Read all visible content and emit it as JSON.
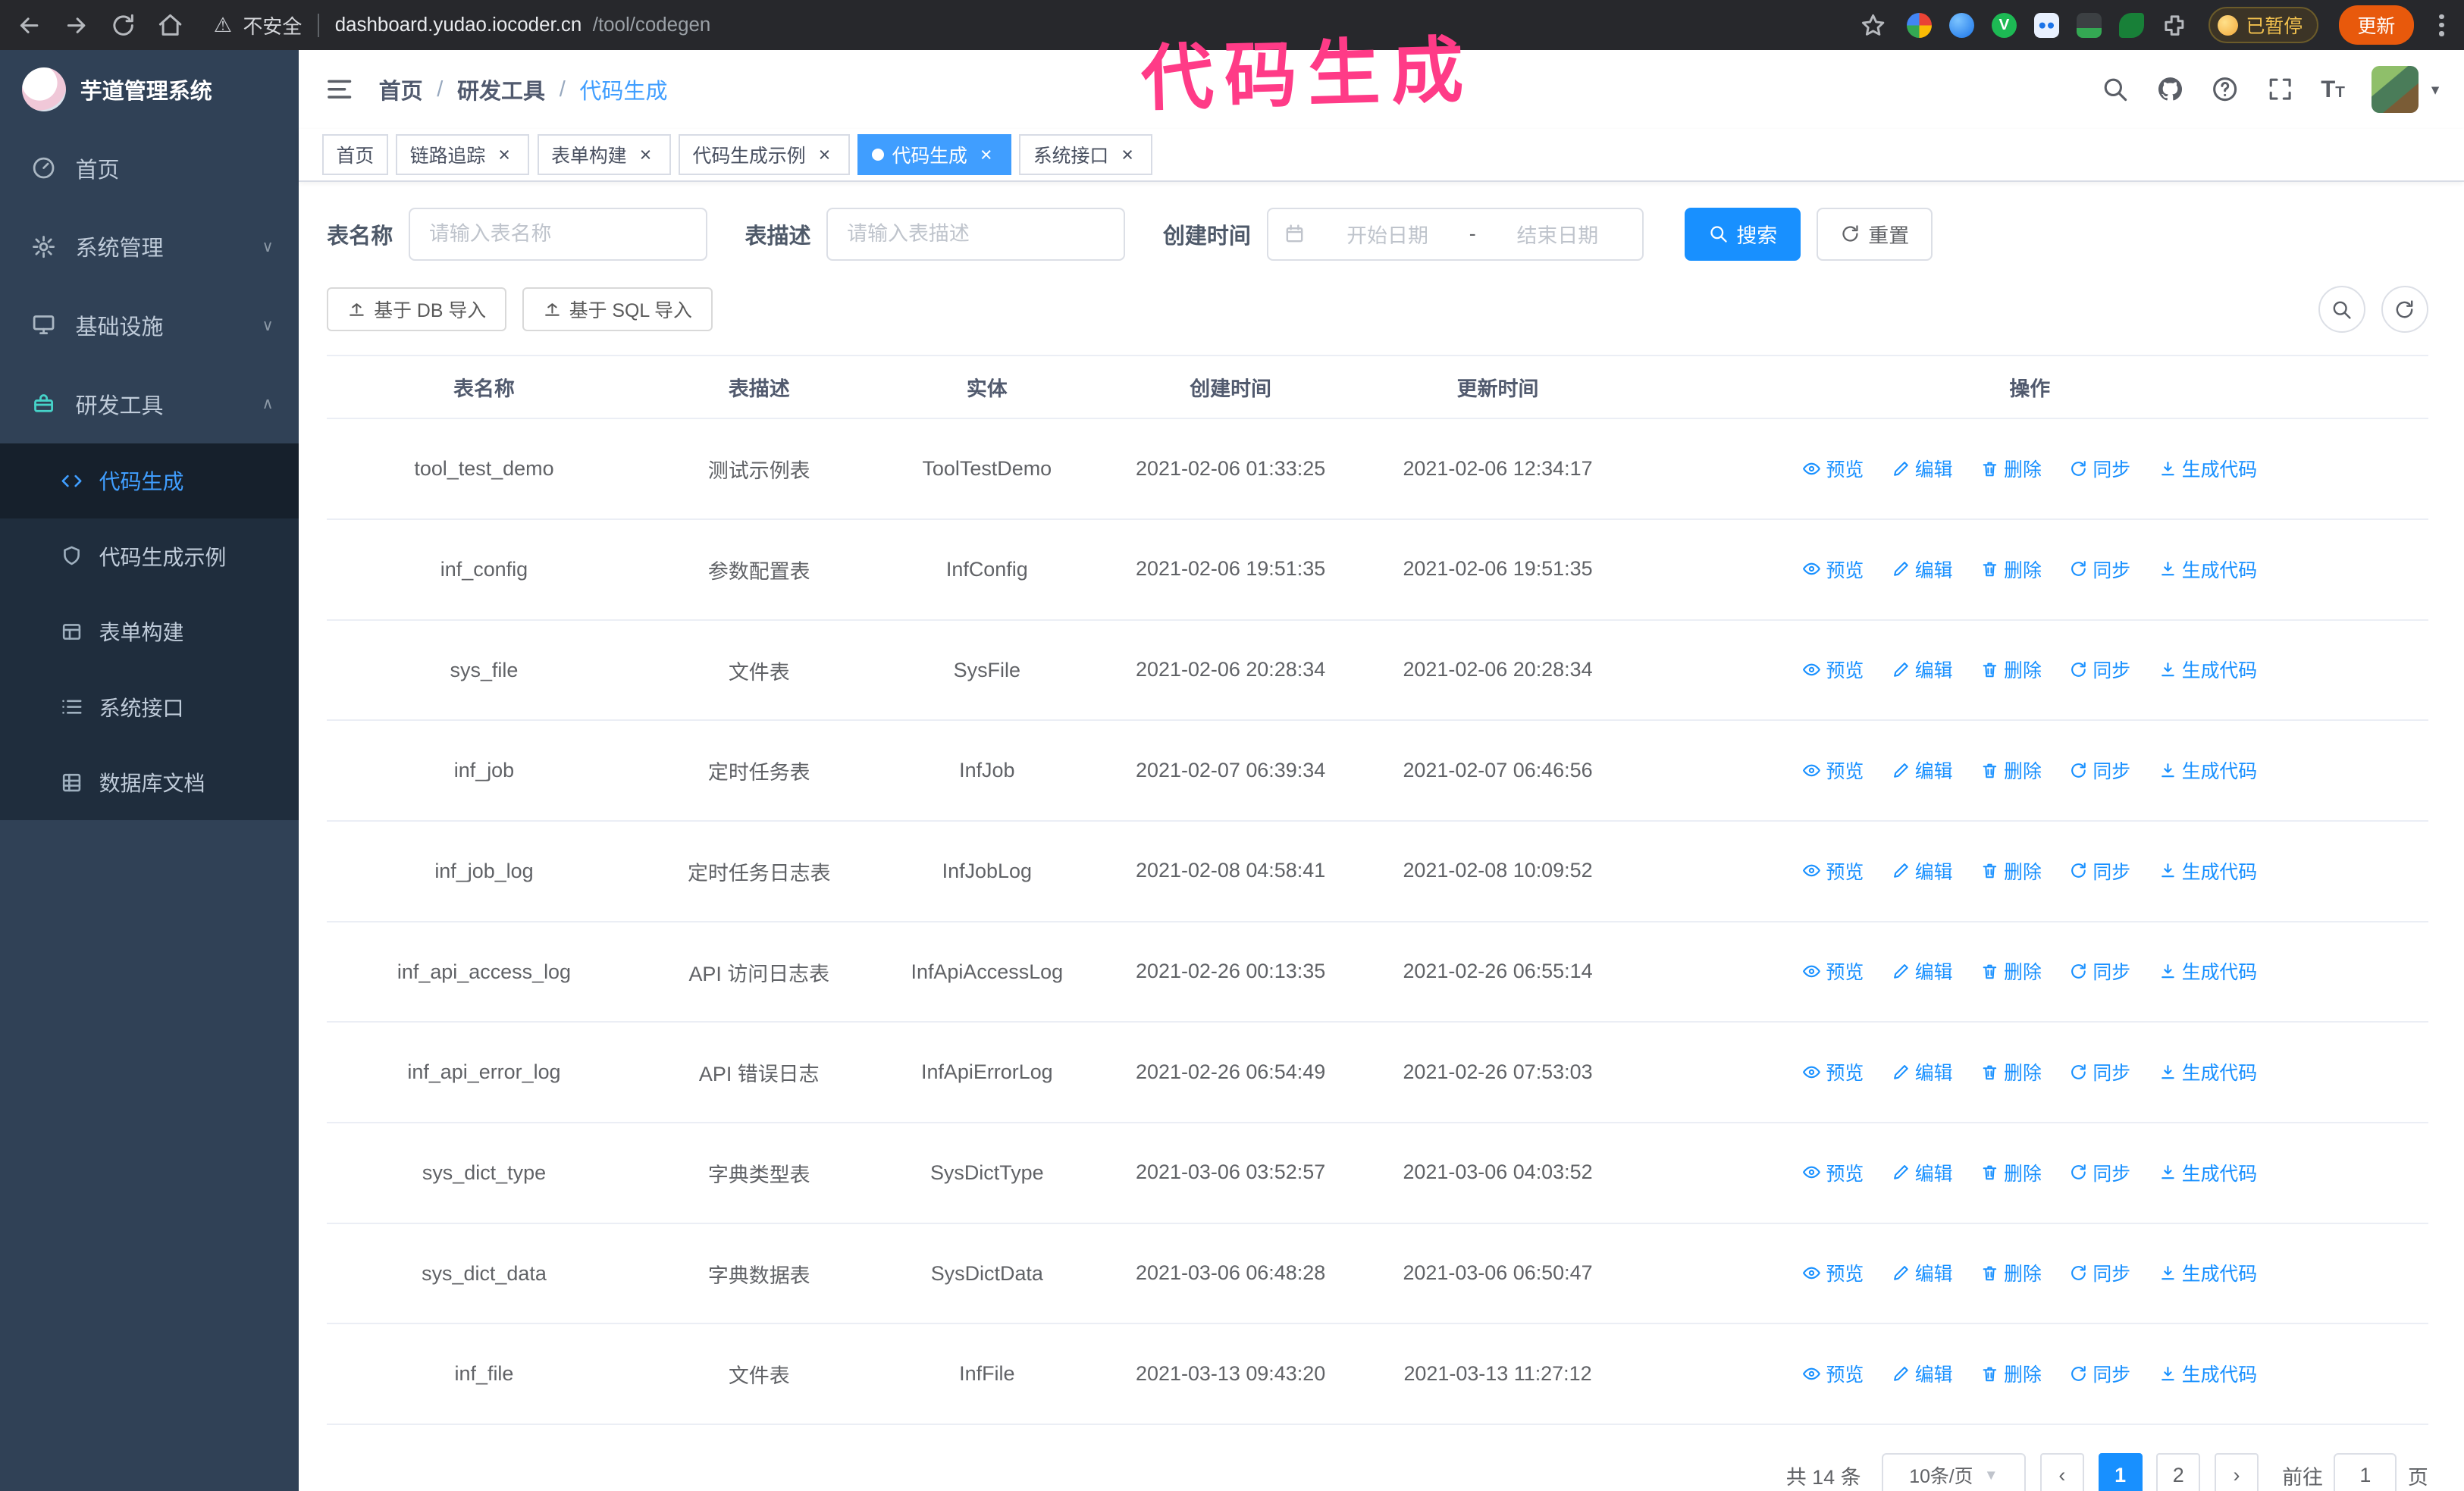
{
  "theme": {
    "primary": "#1890ff",
    "accent": "#409eff",
    "sidebar_bg": "#304156",
    "submenu_bg": "#1f2d3d",
    "chrome_bg": "#27282c",
    "annotation": "#ff3b87",
    "update_btn": "#e8590c"
  },
  "annotation": {
    "text": "代码生成"
  },
  "browser": {
    "security_label": "不安全",
    "url_host": "dashboard.yudao.iocoder.cn",
    "url_path": "/tool/codegen",
    "paused_badge": "已暂停",
    "update_button": "更新"
  },
  "sidebar": {
    "logo_title": "芋道管理系统",
    "items": [
      {
        "label": "首页",
        "chevron": ""
      },
      {
        "label": "系统管理",
        "chevron": "∨"
      },
      {
        "label": "基础设施",
        "chevron": "∨"
      },
      {
        "label": "研发工具",
        "chevron": "∧"
      }
    ],
    "subitems": [
      {
        "label": "代码生成",
        "state": "submenu-item is-active"
      },
      {
        "label": "代码生成示例",
        "state": "submenu-item"
      },
      {
        "label": "表单构建",
        "state": "submenu-item"
      },
      {
        "label": "系统接口",
        "state": "submenu-item"
      },
      {
        "label": "数据库文档",
        "state": "submenu-item"
      }
    ]
  },
  "header": {
    "breadcrumb": [
      "首页",
      "研发工具",
      "代码生成"
    ],
    "separator": "/"
  },
  "tabs": [
    {
      "label": "首页",
      "close": "",
      "state": "tag"
    },
    {
      "label": "链路追踪",
      "close": "×",
      "state": "tag"
    },
    {
      "label": "表单构建",
      "close": "×",
      "state": "tag"
    },
    {
      "label": "代码生成示例",
      "close": "×",
      "state": "tag"
    },
    {
      "label": "代码生成",
      "close": "×",
      "state": "tag is-active"
    },
    {
      "label": "系统接口",
      "close": "×",
      "state": "tag"
    }
  ],
  "filters": {
    "table_name_label": "表名称",
    "table_name_placeholder": "请输入表名称",
    "table_desc_label": "表描述",
    "table_desc_placeholder": "请输入表描述",
    "create_time_label": "创建时间",
    "date_start_placeholder": "开始日期",
    "date_separator": "-",
    "date_end_placeholder": "结束日期",
    "search_button": "搜索",
    "reset_button": "重置"
  },
  "toolbar": {
    "import_db": "基于 DB 导入",
    "import_sql": "基于 SQL 导入"
  },
  "table": {
    "columns": [
      "表名称",
      "表描述",
      "实体",
      "创建时间",
      "更新时间",
      "操作"
    ],
    "actions": [
      "预览",
      "编辑",
      "删除",
      "同步",
      "生成代码"
    ],
    "rows": [
      {
        "name": "tool_test_demo",
        "desc": "测试示例表",
        "entity": "ToolTestDemo",
        "create_time": "2021-02-06 01:33:25",
        "update_time": "2021-02-06 12:34:17"
      },
      {
        "name": "inf_config",
        "desc": "参数配置表",
        "entity": "InfConfig",
        "create_time": "2021-02-06 19:51:35",
        "update_time": "2021-02-06 19:51:35"
      },
      {
        "name": "sys_file",
        "desc": "文件表",
        "entity": "SysFile",
        "create_time": "2021-02-06 20:28:34",
        "update_time": "2021-02-06 20:28:34"
      },
      {
        "name": "inf_job",
        "desc": "定时任务表",
        "entity": "InfJob",
        "create_time": "2021-02-07 06:39:34",
        "update_time": "2021-02-07 06:46:56"
      },
      {
        "name": "inf_job_log",
        "desc": "定时任务日志表",
        "entity": "InfJobLog",
        "create_time": "2021-02-08 04:58:41",
        "update_time": "2021-02-08 10:09:52"
      },
      {
        "name": "inf_api_access_log",
        "desc": "API 访问日志表",
        "entity": "InfApiAccessLog",
        "create_time": "2021-02-26 00:13:35",
        "update_time": "2021-02-26 06:55:14"
      },
      {
        "name": "inf_api_error_log",
        "desc": "API 错误日志",
        "entity": "InfApiErrorLog",
        "create_time": "2021-02-26 06:54:49",
        "update_time": "2021-02-26 07:53:03"
      },
      {
        "name": "sys_dict_type",
        "desc": "字典类型表",
        "entity": "SysDictType",
        "create_time": "2021-03-06 03:52:57",
        "update_time": "2021-03-06 04:03:52"
      },
      {
        "name": "sys_dict_data",
        "desc": "字典数据表",
        "entity": "SysDictData",
        "create_time": "2021-03-06 06:48:28",
        "update_time": "2021-03-06 06:50:47"
      },
      {
        "name": "inf_file",
        "desc": "文件表",
        "entity": "InfFile",
        "create_time": "2021-03-13 09:43:20",
        "update_time": "2021-03-13 11:27:12"
      }
    ]
  },
  "pagination": {
    "total": "共 14 条",
    "page_size": "10条/页",
    "pages": [
      {
        "label": "1",
        "state": "page-btn is-active"
      },
      {
        "label": "2",
        "state": "page-btn"
      }
    ],
    "prev": "‹",
    "next": "›",
    "goto_label": "前往",
    "goto_value": "1",
    "goto_suffix": "页"
  }
}
